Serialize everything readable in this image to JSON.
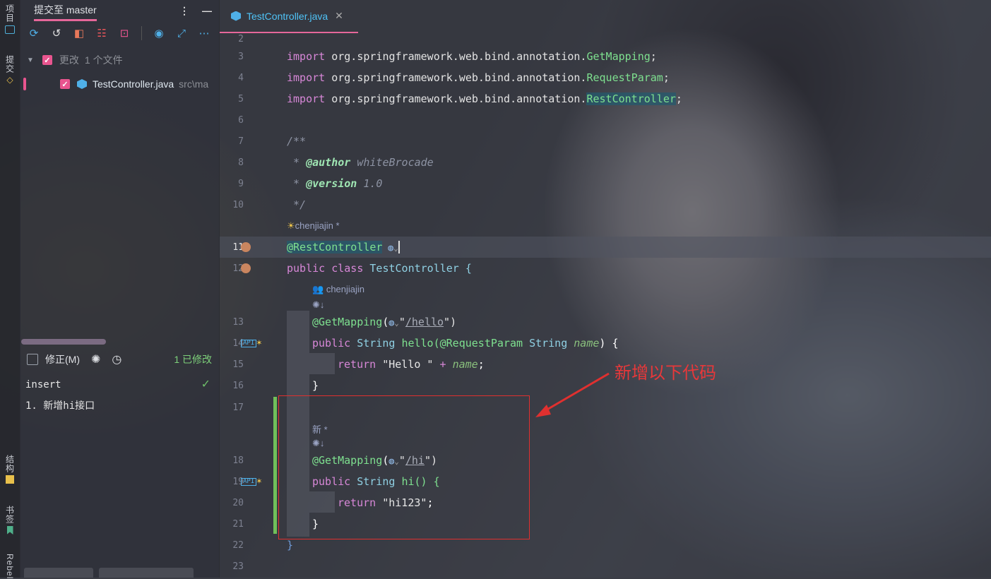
{
  "sidebar": {
    "project_label": "项目",
    "commit_label": "提交",
    "structure_label": "结构",
    "bookmarks_label": "书签",
    "rebel_label": "Rebel"
  },
  "commit_panel": {
    "title": "提交至 master",
    "changes_label": "更改",
    "changes_count": "1 个文件",
    "file_name": "TestController.java",
    "file_path": "src\\ma",
    "amend_label": "修正(M)",
    "modified_count": "1 已修改",
    "message_line1": "insert",
    "message_line2": "1. 新增hi接口"
  },
  "editor": {
    "tab_title": "TestController.java",
    "author_hint": "chenjiajin *",
    "method_author_hint": "chenjiajin",
    "new_hint": "新 *",
    "lines": {
      "l2": "2",
      "l3": "3",
      "l4": "4",
      "l5": "5",
      "l6": "6",
      "l7": "7",
      "l8": "8",
      "l9": "9",
      "l10": "10",
      "l11": "11",
      "l12": "12",
      "l13": "13",
      "l14": "14",
      "l15": "15",
      "l16": "16",
      "l17": "17",
      "l18": "18",
      "l19": "19",
      "l20": "20",
      "l21": "21",
      "l22": "22",
      "l23": "23"
    },
    "code": {
      "import_kw": "import",
      "pkg": "org.springframework.web.bind.annotation.",
      "get_mapping": "GetMapping",
      "request_param": "RequestParam",
      "rest_controller": "RestController",
      "semi": ";",
      "doc_open": "/**",
      "star": " * ",
      "author_tag": "@author",
      "author_val": "whiteBrocade",
      "version_tag": "@version",
      "version_val": "1.0",
      "doc_close": " */",
      "rest_anno": "@RestController",
      "public_kw": "public",
      "class_kw": "class",
      "class_name": "TestController {",
      "gm_anno": "@GetMapping",
      "hello_path": "/hello",
      "string_type": "String",
      "hello_sig": "hello(",
      "rp_anno": "@RequestParam",
      "param_name": "name",
      "close_paren_brace": ") {",
      "return_kw": "return",
      "hello_str": "\"Hello \"",
      "plus": " + ",
      "close_brace": "}",
      "hi_path": "/hi",
      "hi_sig": "hi() {",
      "hi_str": "\"hi123\""
    }
  },
  "annotation": {
    "note": "新增以下代码"
  }
}
